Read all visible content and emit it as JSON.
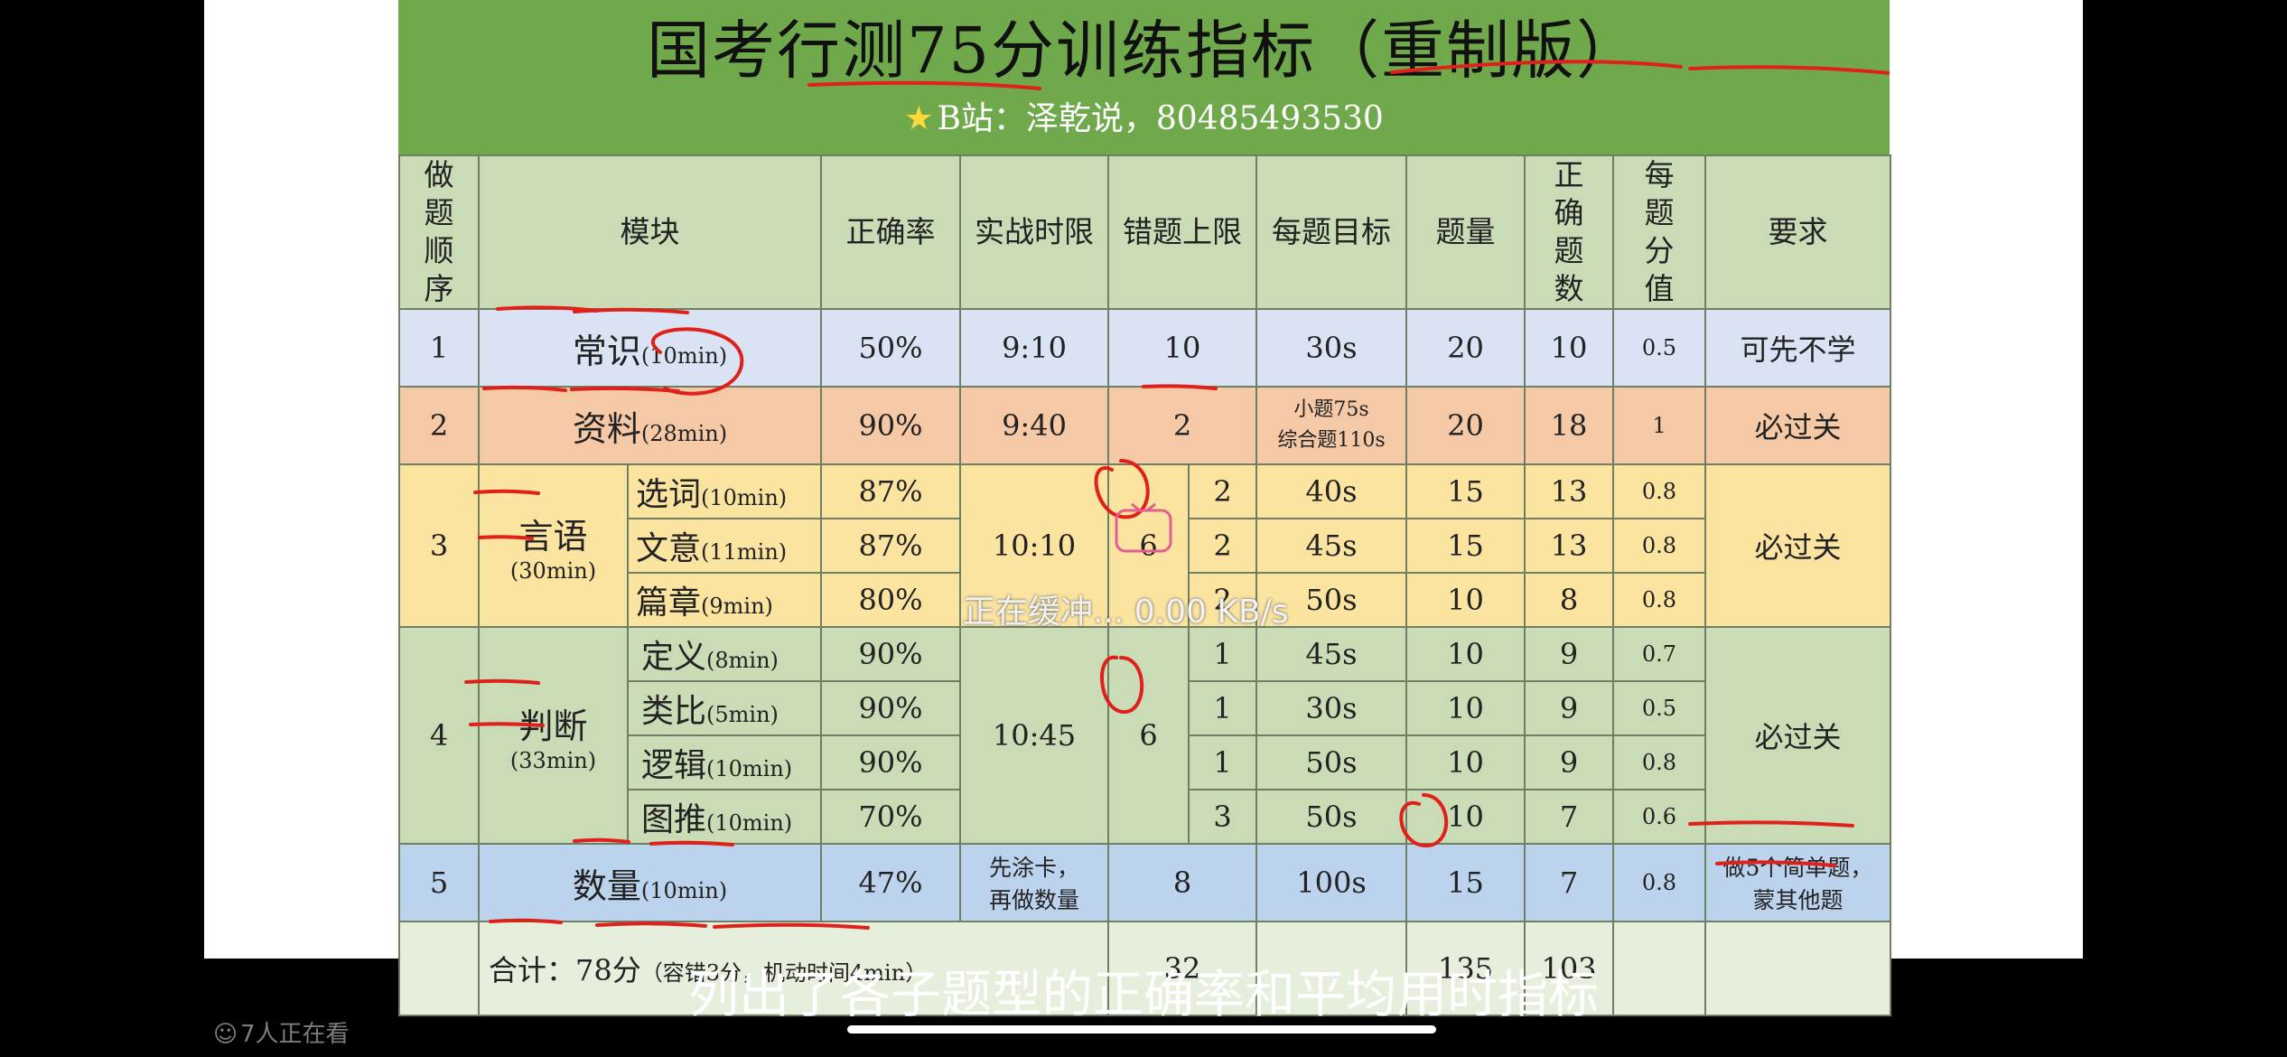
{
  "doc": {
    "title": "国考行测75分训练指标（重制版）",
    "subtitle": "B站：泽乾说，80485493530",
    "headers": [
      "做题顺序",
      "模块",
      "正确率",
      "实战时限",
      "错题上限",
      "每题目标",
      "题量",
      "正确题数",
      "每题分值",
      "要求"
    ],
    "rows": {
      "r1": {
        "order": "1",
        "module": "常识",
        "module_time": "(10min)",
        "rate": "50%",
        "limit": "9:10",
        "errors": "10",
        "target": "30s",
        "count": "20",
        "correct": "10",
        "score": "0.5",
        "req": "可先不学"
      },
      "r2": {
        "order": "2",
        "module": "资料",
        "module_time": "(28min)",
        "rate": "90%",
        "limit": "9:40",
        "errors": "2",
        "target_line1": "小题75s",
        "target_line2": "综合题110s",
        "count": "20",
        "correct": "18",
        "score": "1",
        "req": "必过关"
      },
      "r3": {
        "order": "3",
        "module": "言语",
        "module_time": "(30min)",
        "limit": "10:10",
        "errors": "6",
        "req": "必过关",
        "subs": [
          {
            "name": "选词",
            "time": "(10min)",
            "rate": "87%",
            "err": "2",
            "target": "40s",
            "count": "15",
            "correct": "13",
            "score": "0.8"
          },
          {
            "name": "文意",
            "time": "(11min)",
            "rate": "87%",
            "err": "2",
            "target": "45s",
            "count": "15",
            "correct": "13",
            "score": "0.8"
          },
          {
            "name": "篇章",
            "time": "(9min)",
            "rate": "80%",
            "err": "2",
            "target": "50s",
            "count": "10",
            "correct": "8",
            "score": "0.8"
          }
        ]
      },
      "r4": {
        "order": "4",
        "module": "判断",
        "module_time": "(33min)",
        "limit": "10:45",
        "errors": "6",
        "req": "必过关",
        "subs": [
          {
            "name": "定义",
            "time": "(8min)",
            "rate": "90%",
            "err": "1",
            "target": "45s",
            "count": "10",
            "correct": "9",
            "score": "0.7"
          },
          {
            "name": "类比",
            "time": "(5min)",
            "rate": "90%",
            "err": "1",
            "target": "30s",
            "count": "10",
            "correct": "9",
            "score": "0.5"
          },
          {
            "name": "逻辑",
            "time": "(10min)",
            "rate": "90%",
            "err": "1",
            "target": "50s",
            "count": "10",
            "correct": "9",
            "score": "0.8"
          },
          {
            "name": "图推",
            "time": "(10min)",
            "rate": "70%",
            "err": "3",
            "target": "50s",
            "count": "10",
            "correct": "7",
            "score": "0.6"
          }
        ]
      },
      "r5": {
        "order": "5",
        "module": "数量",
        "module_time": "(10min)",
        "rate": "47%",
        "limit_line1": "先涂卡，",
        "limit_line2": "再做数量",
        "errors": "8",
        "target": "100s",
        "count": "15",
        "correct": "7",
        "score": "0.8",
        "req_line1": "做5个简单题，",
        "req_line2": "蒙其他题"
      },
      "total": {
        "label": "合计：",
        "score": "78分",
        "paren_open": "（",
        "tol": "容错3分",
        "sep": "，",
        "flex": "机动时间4min",
        "paren_close": "）",
        "errors": "32",
        "count": "135",
        "correct": "103"
      }
    }
  },
  "overlay": {
    "buffering": "正在缓冲... 0.00 KB/s",
    "caption": "列出了各子题型的正确率和平均用时指标",
    "viewers": "7人正在看"
  },
  "icons": {
    "star": "star-icon",
    "viewers": "people-icon"
  },
  "colors": {
    "title_band": "#70a94c",
    "ink": "#e0201b"
  }
}
